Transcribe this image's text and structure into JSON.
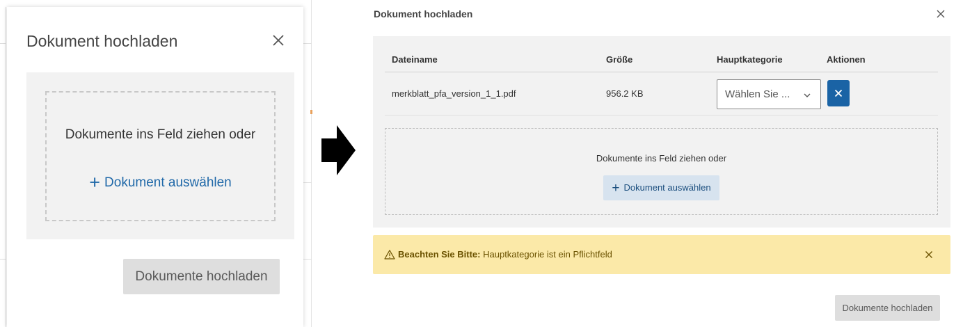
{
  "left_dialog": {
    "title": "Dokument hochladen",
    "close_icon": "close-icon",
    "dropzone_text": "Dokumente ins Feld ziehen oder",
    "choose_label": "Dokument auswählen",
    "upload_label": "Dokumente hochladen"
  },
  "arrow_icon": "arrow-right-icon",
  "right_dialog": {
    "title": "Dokument hochladen",
    "close_icon": "close-icon",
    "table": {
      "headers": [
        "Dateiname",
        "Größe",
        "Hauptkategorie",
        "Aktionen"
      ],
      "rows": [
        {
          "filename": "merkblatt_pfa_version_1_1.pdf",
          "size": "956.2 KB",
          "category_placeholder": "Wählen Sie ...",
          "action_icon": "close-icon"
        }
      ]
    },
    "dropzone_text": "Dokumente ins Feld ziehen oder",
    "choose_label": "Dokument auswählen",
    "alert": {
      "icon": "warning-icon",
      "label": "Beachten Sie Bitte:",
      "message": "Hauptkategorie ist ein Pflichtfeld",
      "close_icon": "close-icon"
    },
    "upload_label": "Dokumente hochladen"
  },
  "colors": {
    "accent_blue": "#1a63a5",
    "link_blue": "#1f68a8",
    "panel_gray": "#f2f2f2",
    "disabled_button": "#dedede",
    "alert_yellow": "#fbe9a8",
    "alert_text": "#6b5200"
  }
}
